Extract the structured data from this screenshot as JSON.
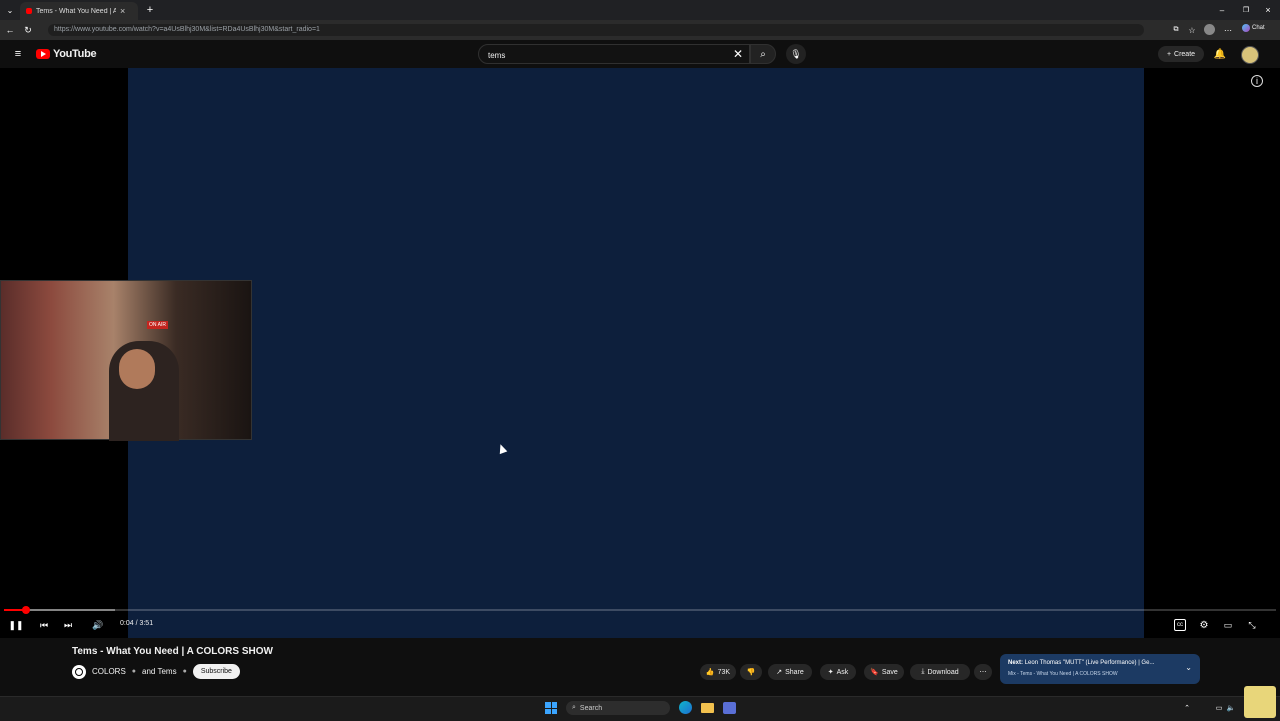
{
  "browser": {
    "tab_title": "Tems - What You Need | A CO",
    "url": "https://www.youtube.com/watch?v=a4UsBlhj30M&list=RDa4UsBlhj30M&start_radio=1",
    "chat_label": "Chat"
  },
  "header": {
    "logo_text": "YouTube",
    "search_value": "tems",
    "create_label": "Create"
  },
  "player": {
    "time": "0:04 / 3:51",
    "progress_fraction": 0.0173,
    "buffered_fraction": 0.087,
    "video_color": "#0d1f3c",
    "onair_text": "ON AIR"
  },
  "video": {
    "title": "Tems - What You Need | A COLORS SHOW",
    "channel": "COLORS",
    "channel_joiner": "and Tems",
    "subscribe_label": "Subscribe",
    "likes": "73K",
    "share_label": "Share",
    "ask_label": "Ask",
    "save_label": "Save",
    "download_label": "Download"
  },
  "next_up": {
    "label": "Next:",
    "title": "Leon Thomas \"MUTT\" (Live Performance) | Ge...",
    "subtitle": "Mix - Tems - What You Need | A COLORS SHOW"
  },
  "taskbar": {
    "search_label": "Search"
  },
  "colors": {
    "accent": "#ff0000",
    "background": "#0f0f0f",
    "next_bg": "#1c3a63"
  }
}
